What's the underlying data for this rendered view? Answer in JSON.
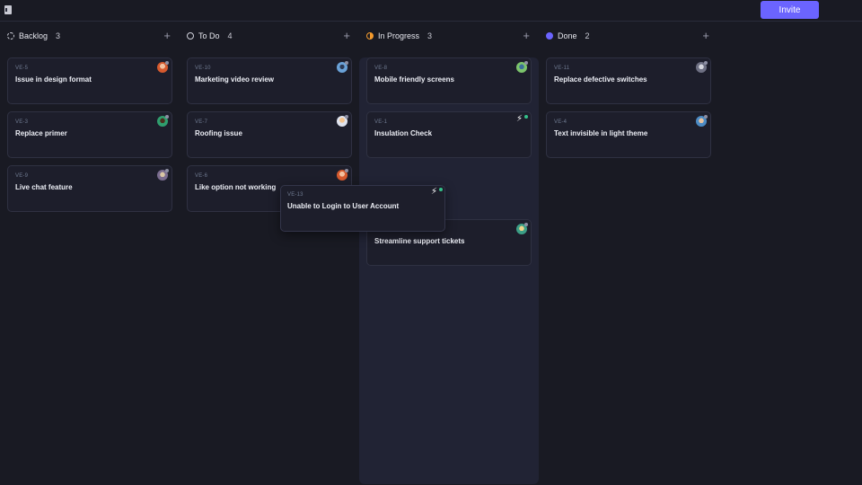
{
  "header": {
    "sidebar_toggle_icon": "sidebar-panel-icon",
    "invite_label": "Invite",
    "accent": "#6b64ff"
  },
  "columns": [
    {
      "title": "Backlog",
      "count": "3",
      "status_icon": "dashed-circle-icon",
      "cards": [
        {
          "id": "VE-5",
          "title": "Issue in design format",
          "avatar": "orange"
        },
        {
          "id": "VE-3",
          "title": "Replace primer",
          "avatar": "green"
        },
        {
          "id": "VE-9",
          "title": "Live chat feature",
          "avatar": "purple"
        }
      ]
    },
    {
      "title": "To Do",
      "count": "4",
      "status_icon": "circle-icon",
      "cards": [
        {
          "id": "VE-10",
          "title": "Marketing video review",
          "avatar": "blue"
        },
        {
          "id": "VE-7",
          "title": "Roofing issue",
          "avatar": "light"
        },
        {
          "id": "VE-6",
          "title": "Like option not working",
          "avatar": "orange"
        }
      ]
    },
    {
      "title": "In Progress",
      "count": "3",
      "status_icon": "half-circle-icon",
      "cards": [
        {
          "id": "VE-8",
          "title": "Mobile friendly screens",
          "avatar": "teal"
        },
        {
          "id": "VE-1",
          "title": "Insulation Check",
          "avatar": "bolt"
        },
        {
          "id": "",
          "title": "Streamline support tickets",
          "avatar": "mint"
        }
      ]
    },
    {
      "title": "Done",
      "count": "2",
      "status_icon": "check-circle-icon",
      "cards": [
        {
          "id": "VE-11",
          "title": "Replace defective switches",
          "avatar": "gray"
        },
        {
          "id": "VE-4",
          "title": "Text invisible in light theme",
          "avatar": "brown"
        }
      ]
    }
  ],
  "dragging_card": {
    "id": "VE-13",
    "title": "Unable to Login to User Account",
    "avatar": "bolt"
  },
  "add_icon": "+"
}
